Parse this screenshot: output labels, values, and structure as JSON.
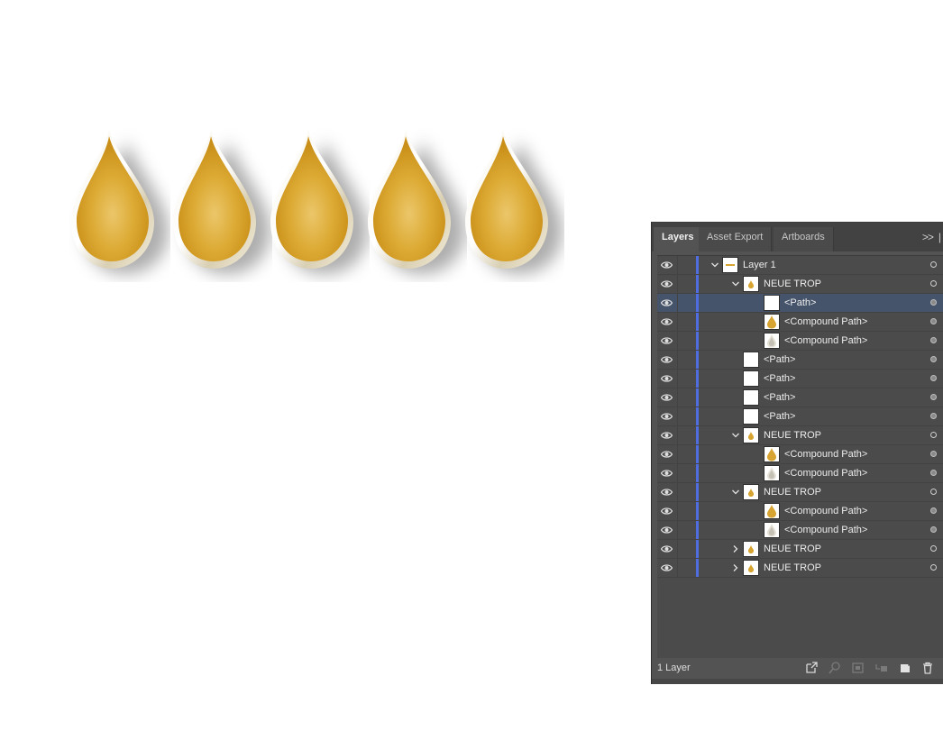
{
  "tabs": [
    {
      "label": "Layers",
      "active": true
    },
    {
      "label": "Asset Export",
      "active": false
    },
    {
      "label": "Artboards",
      "active": false
    }
  ],
  "panel_menu_glyph": ">>",
  "layers": [
    {
      "label": "Layer 1",
      "depth": 0,
      "expander": "open",
      "thumb": "group",
      "target": "hollow",
      "selected": false
    },
    {
      "label": "NEUE TROP",
      "depth": 1,
      "expander": "open",
      "thumb": "small-drop",
      "target": "hollow",
      "selected": false
    },
    {
      "label": "<Path>",
      "depth": 2,
      "expander": "none",
      "thumb": "blank",
      "target": "filled",
      "selected": true
    },
    {
      "label": "<Compound Path>",
      "depth": 2,
      "expander": "none",
      "thumb": "drop",
      "target": "filled",
      "selected": false
    },
    {
      "label": "<Compound Path>",
      "depth": 2,
      "expander": "none",
      "thumb": "ring",
      "target": "filled",
      "selected": false
    },
    {
      "label": "<Path>",
      "depth": 1,
      "expander": "none",
      "thumb": "blank",
      "target": "filled",
      "selected": false
    },
    {
      "label": "<Path>",
      "depth": 1,
      "expander": "none",
      "thumb": "blank",
      "target": "filled",
      "selected": false
    },
    {
      "label": "<Path>",
      "depth": 1,
      "expander": "none",
      "thumb": "blank",
      "target": "filled",
      "selected": false
    },
    {
      "label": "<Path>",
      "depth": 1,
      "expander": "none",
      "thumb": "blank",
      "target": "filled",
      "selected": false
    },
    {
      "label": "NEUE TROP",
      "depth": 1,
      "expander": "open",
      "thumb": "small-drop",
      "target": "hollow",
      "selected": false
    },
    {
      "label": "<Compound Path>",
      "depth": 2,
      "expander": "none",
      "thumb": "drop",
      "target": "filled",
      "selected": false
    },
    {
      "label": "<Compound Path>",
      "depth": 2,
      "expander": "none",
      "thumb": "ring",
      "target": "filled",
      "selected": false
    },
    {
      "label": "NEUE TROP",
      "depth": 1,
      "expander": "open",
      "thumb": "small-drop",
      "target": "hollow",
      "selected": false
    },
    {
      "label": "<Compound Path>",
      "depth": 2,
      "expander": "none",
      "thumb": "drop",
      "target": "filled",
      "selected": false
    },
    {
      "label": "<Compound Path>",
      "depth": 2,
      "expander": "none",
      "thumb": "ring",
      "target": "filled",
      "selected": false
    },
    {
      "label": "NEUE TROP",
      "depth": 1,
      "expander": "closed",
      "thumb": "small-drop",
      "target": "hollow",
      "selected": false
    },
    {
      "label": "NEUE TROP",
      "depth": 1,
      "expander": "closed",
      "thumb": "small-drop",
      "target": "hollow",
      "selected": false
    }
  ],
  "footer": {
    "layer_count": "1 Layer",
    "icons": [
      "export-icon",
      "locate-object-icon",
      "make-clipping-mask-icon",
      "create-sublayer-icon",
      "new-layer-icon",
      "trash-icon"
    ]
  },
  "colors": {
    "gold": "#d9a62a",
    "gold_light": "#ebc25a",
    "layer_color_bar": "#4f6ddf",
    "selected_row": "#46546b",
    "panel_bg": "#535353"
  },
  "canvas": {
    "drop_count": 5
  }
}
